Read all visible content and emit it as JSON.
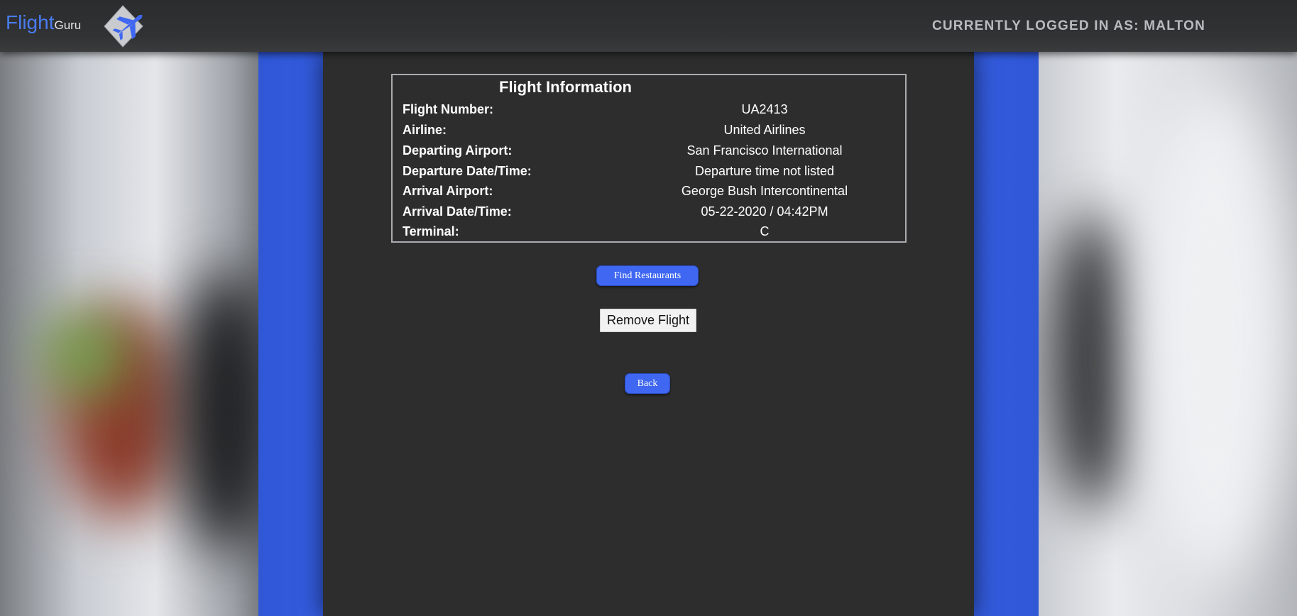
{
  "header": {
    "brand_main": "Flight",
    "brand_sub": "Guru",
    "logo_icon": "plane-diamond-icon",
    "login_status": "CURRENTLY LOGGED IN AS: MALTON"
  },
  "flight_info": {
    "title": "Flight Information",
    "rows": [
      {
        "label": "Flight Number:",
        "value": "UA2413"
      },
      {
        "label": "Airline:",
        "value": "United Airlines"
      },
      {
        "label": "Departing Airport:",
        "value": "San Francisco International"
      },
      {
        "label": "Departure Date/Time:",
        "value": "Departure time not listed"
      },
      {
        "label": "Arrival Airport:",
        "value": "George Bush Intercontinental"
      },
      {
        "label": "Arrival Date/Time:",
        "value": "05-22-2020 / 04:42PM"
      },
      {
        "label": "Terminal:",
        "value": "C"
      }
    ]
  },
  "actions": {
    "find_restaurants": "Find Restaurants",
    "remove_flight": "Remove Flight",
    "back": "Back"
  },
  "colors": {
    "accent": "#3f67f1",
    "panel": "#2d2d2e",
    "topbar": "#2b2c2e"
  }
}
